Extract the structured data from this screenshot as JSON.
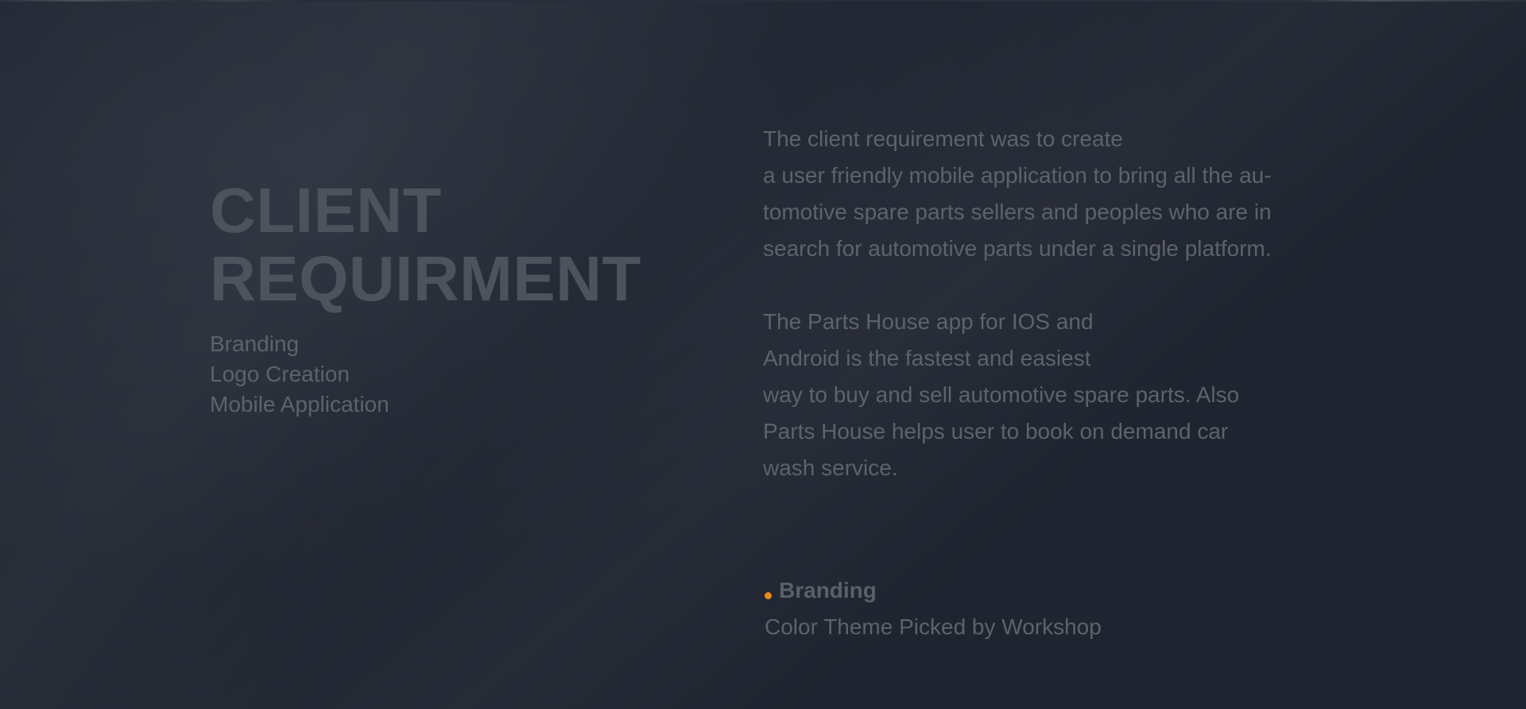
{
  "colors": {
    "background": "#1f2430",
    "heading": "#4d525c",
    "text": "#5d626d",
    "accent": "#e8891e"
  },
  "heading": {
    "lines": [
      "CLIENT",
      "REQUIRMENT"
    ]
  },
  "services": [
    "Branding",
    "Logo Creation",
    "Mobile Application"
  ],
  "description": {
    "paragraph1": [
      "The client requirement was to create",
      "a user friendly mobile application to bring all the au-",
      "tomotive spare parts sellers and peoples who are in",
      "search for automotive parts under a single platform."
    ],
    "paragraph2": [
      "The Parts House app for IOS and",
      "Android is the fastest and easiest",
      "way to buy and sell automotive spare parts. Also",
      "Parts House helps user to book on demand car",
      "wash service."
    ]
  },
  "feature": {
    "icon": "bullet-dot-icon",
    "title": "Branding",
    "description": "Color Theme Picked by Workshop"
  }
}
